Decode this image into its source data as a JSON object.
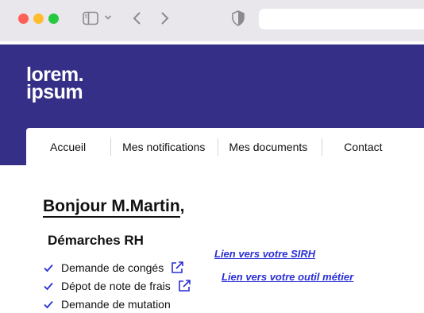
{
  "browser": {
    "icons": [
      "sidebar-icon",
      "chevron-down-icon",
      "back-arrow-icon",
      "forward-arrow-icon",
      "shield-icon"
    ]
  },
  "site": {
    "logo_line1": "lorem.",
    "logo_line2": "ipsum",
    "brand_color": "#362f87"
  },
  "nav": {
    "items": [
      "Accueil",
      "Mes notifications",
      "Mes documents",
      "Contact"
    ]
  },
  "main": {
    "greeting_name": "Bonjour M.Martin",
    "greeting_suffix": ",",
    "section_title": "Démarches RH",
    "items": [
      "Demande de congés",
      "Dépot de note de frais",
      "Demande de mutation"
    ],
    "links": [
      "Lien vers votre SIRH",
      "Lien vers votre outil métier"
    ],
    "link_color": "#2a2fd6"
  }
}
